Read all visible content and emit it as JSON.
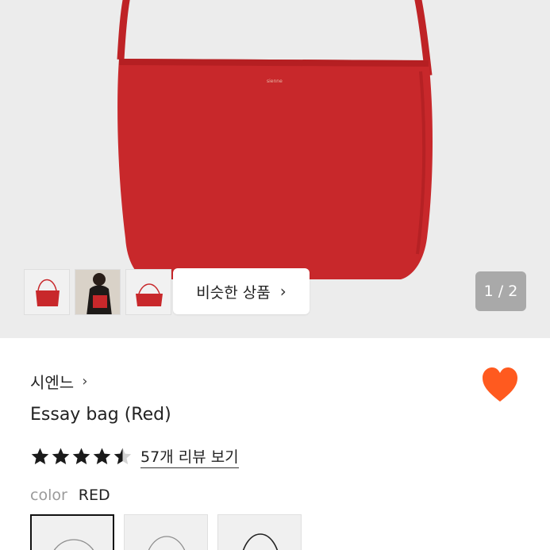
{
  "gallery": {
    "similar_button_label": "비슷한 상품",
    "chevron_glyph": "›",
    "pager_text": "1 / 2",
    "thumbnails": [
      "bag-front",
      "model-wearing-bag",
      "bag-side"
    ],
    "bag_color": "#c8282b"
  },
  "product": {
    "brand": "시엔느",
    "brand_chevron": "›",
    "name": "Essay bag (Red)",
    "rating": 4.5,
    "review_link": "57개 리뷰 보기",
    "favorited": true,
    "heart_color": "#ff5a1f"
  },
  "options": {
    "color_label": "color",
    "color_value": "RED",
    "swatches": [
      "red",
      "beige",
      "black"
    ],
    "selected_index": 0
  }
}
